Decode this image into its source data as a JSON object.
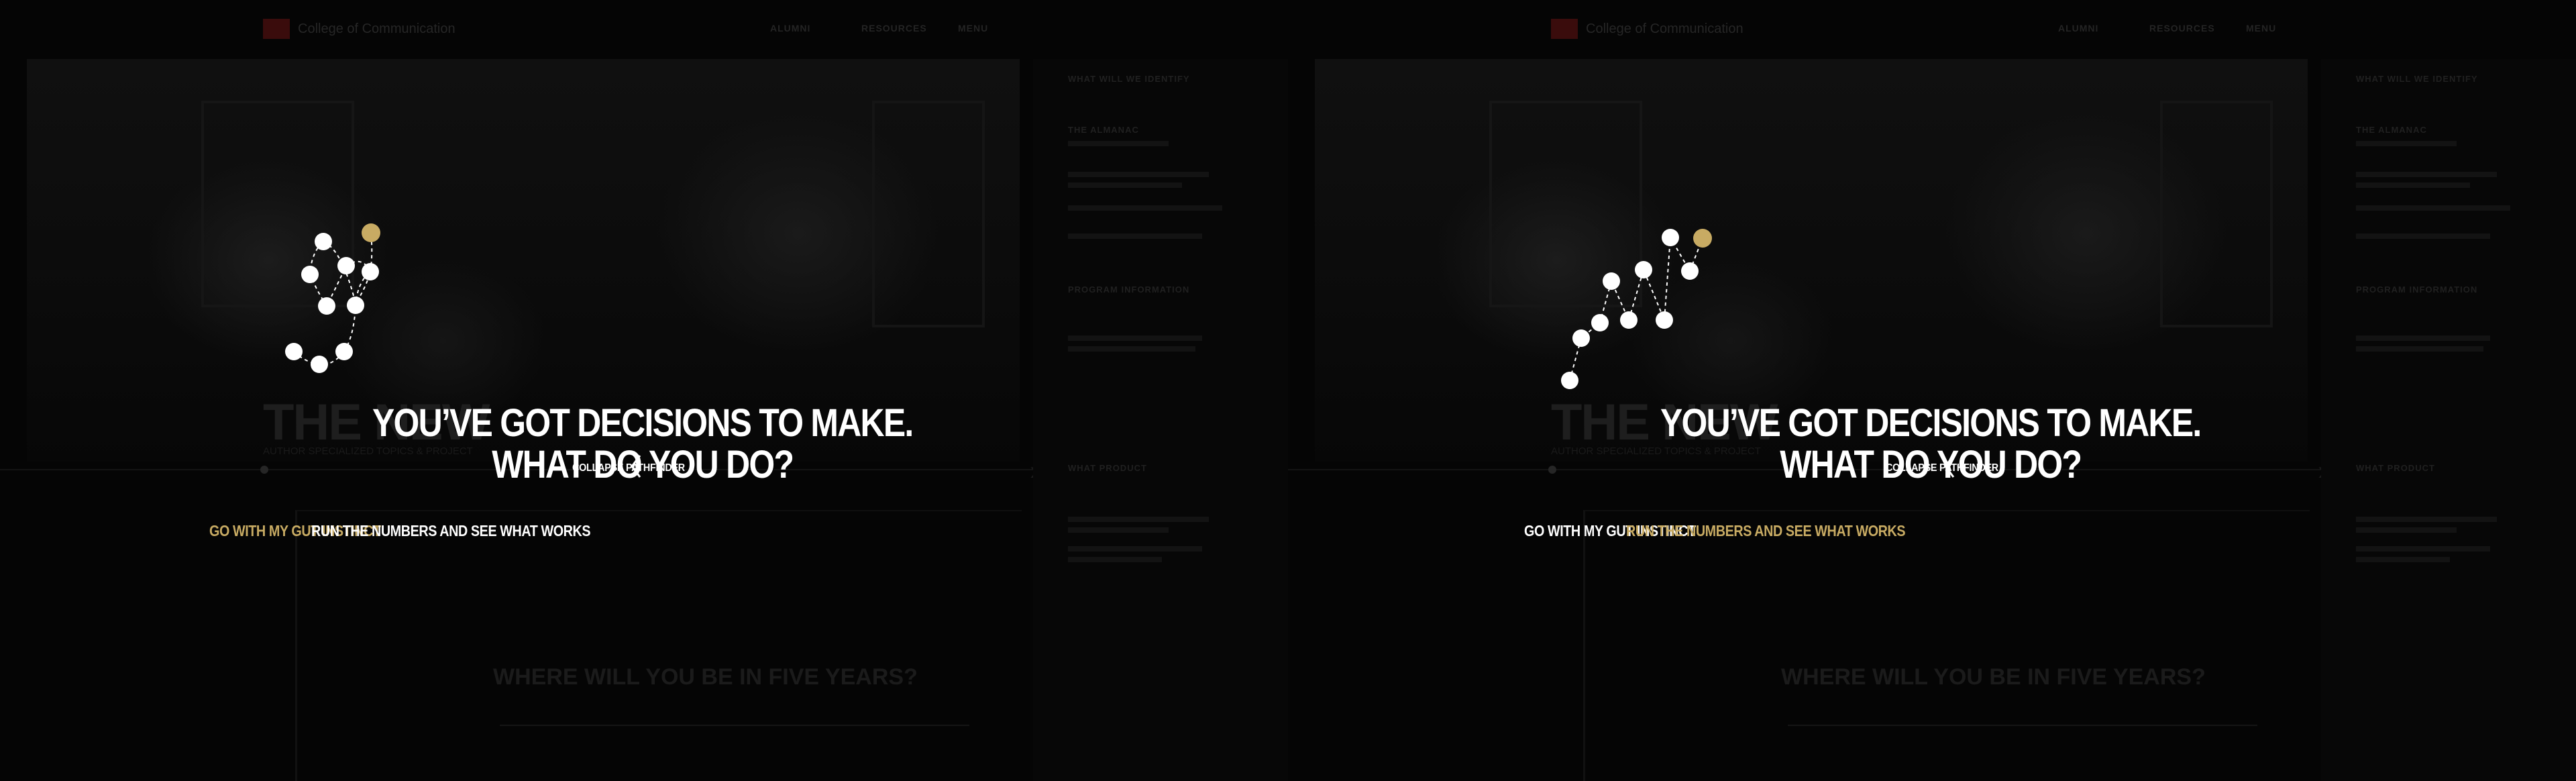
{
  "background_page": {
    "brand": "College of Communication",
    "nav": [
      "ALUMNI",
      "RESOURCES",
      "MENU"
    ],
    "hero_title": "THE NEW",
    "hero_subtitle": "AUTHOR SPECIALIZED TOPICS & PROJECT",
    "section_question": "WHERE WILL YOU BE IN FIVE YEARS?",
    "sidebar_headings": [
      "WHAT WILL WE IDENTIFY",
      "THE ALMANAC",
      "PROGRAM INFORMATION",
      "WHAT PRODUCT"
    ]
  },
  "panels": [
    {
      "headline_line1": "YOU’VE GOT DECISIONS TO MAKE.",
      "headline_line2": "WHAT DO YOU DO?",
      "choice_gut": "GO WITH MY GUT INSTINCT",
      "choice_numbers": "RUN THE NUMBERS AND SEE WHAT WORKS",
      "active_choice": "gut",
      "collapse_label": "COLLAPSE PATHFINDER",
      "diagram": "winding-path"
    },
    {
      "headline_line1": "YOU’VE GOT DECISIONS TO MAKE.",
      "headline_line2": "WHAT DO YOU DO?",
      "choice_gut": "GO WITH MY GUT INSTINCT",
      "choice_numbers": "RUN THE NUMBERS AND SEE WHAT WORKS",
      "active_choice": "numbers",
      "collapse_label": "COLLAPSE PATHFINDER",
      "diagram": "zigzag-path"
    }
  ],
  "colors": {
    "accent_gold": "#c8ab63",
    "text_white": "#ffffff",
    "background": "#050505"
  },
  "icons": {
    "collapse": "chevron-left-icon"
  }
}
